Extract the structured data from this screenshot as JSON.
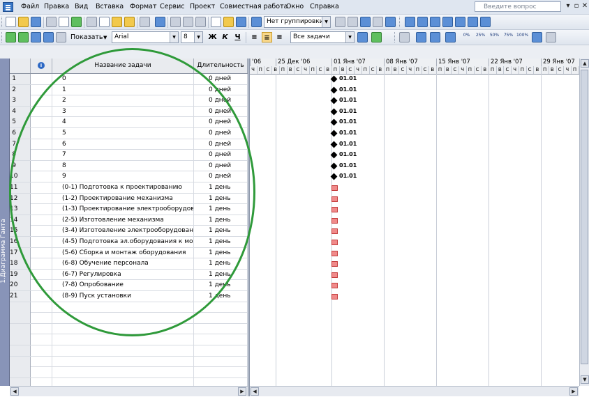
{
  "menu": {
    "items": [
      "Файл",
      "Правка",
      "Вид",
      "Вставка",
      "Формат",
      "Сервис",
      "Проект",
      "Совместная работа",
      "Окно",
      "Справка"
    ],
    "search_placeholder": "Введите вопрос",
    "window_buttons": [
      "▾",
      "▫",
      "✕"
    ]
  },
  "toolbar1": {
    "grouping_value": "Нет группировки"
  },
  "toolbar2": {
    "show_label": "Показать",
    "font_value": "Arial",
    "size_value": "8",
    "bold": "Ж",
    "italic": "К",
    "underline": "Ч",
    "filter_value": "Все задачи",
    "percent_buttons": [
      "0%",
      "25%",
      "50%",
      "75%",
      "100%"
    ]
  },
  "viewbar": {
    "label": "1.Диаграмма Ганта"
  },
  "table": {
    "columns": {
      "id": "",
      "indicator": "",
      "name": "Название задачи",
      "duration": "Длительность"
    },
    "rows": [
      {
        "id": "1",
        "name": "0",
        "duration": "0 дней"
      },
      {
        "id": "2",
        "name": "1",
        "duration": "0 дней"
      },
      {
        "id": "3",
        "name": "2",
        "duration": "0 дней"
      },
      {
        "id": "4",
        "name": "3",
        "duration": "0 дней"
      },
      {
        "id": "5",
        "name": "4",
        "duration": "0 дней"
      },
      {
        "id": "6",
        "name": "5",
        "duration": "0 дней"
      },
      {
        "id": "7",
        "name": "6",
        "duration": "0 дней"
      },
      {
        "id": "8",
        "name": "7",
        "duration": "0 дней"
      },
      {
        "id": "9",
        "name": "8",
        "duration": "0 дней"
      },
      {
        "id": "10",
        "name": "9",
        "duration": "0 дней"
      },
      {
        "id": "11",
        "name": "(0-1) Подготовка к проектированию",
        "duration": "1 день"
      },
      {
        "id": "12",
        "name": "(1-2) Проектирование механизма",
        "duration": "1 день"
      },
      {
        "id": "13",
        "name": "(1-3) Проектирование электрооборудовани",
        "duration": "1 день"
      },
      {
        "id": "14",
        "name": "(2-5) Изготовление механизма",
        "duration": "1 день"
      },
      {
        "id": "15",
        "name": "(3-4) Изготовление электрооборудования",
        "duration": "1 день"
      },
      {
        "id": "16",
        "name": "(4-5) Подготовка эл.оборудования к монтаж",
        "duration": "1 день"
      },
      {
        "id": "17",
        "name": "(5-6) Сборка и монтаж оборудования",
        "duration": "1 день"
      },
      {
        "id": "18",
        "name": "(6-8) Обучение персонала",
        "duration": "1 день"
      },
      {
        "id": "19",
        "name": "(6-7) Регулировка",
        "duration": "1 день"
      },
      {
        "id": "20",
        "name": "(7-8) Опробование",
        "duration": "1 день"
      },
      {
        "id": "21",
        "name": "(8-9) Пуск установки",
        "duration": "1 день"
      }
    ],
    "empty_rows": 8
  },
  "gantt": {
    "weeks": [
      "'06",
      "25 Дек '06",
      "01 Янв '07",
      "08 Янв '07",
      "15 Янв '07",
      "22 Янв '07",
      "29 Янв '07"
    ],
    "day_letters": [
      "Ч",
      "П",
      "С",
      "В",
      "П",
      "В",
      "С",
      "Ч",
      "П",
      "С",
      "В",
      "П",
      "В",
      "С",
      "Ч",
      "П",
      "С",
      "В",
      "П",
      "В",
      "С",
      "Ч",
      "П",
      "С",
      "В",
      "П",
      "В",
      "С",
      "Ч",
      "П",
      "С",
      "В",
      "П",
      "В",
      "С",
      "Ч",
      "П",
      "С",
      "В",
      "П",
      "В",
      "С",
      "Ч",
      "П",
      "С",
      "В",
      "П"
    ],
    "milestone_label": "01.01",
    "milestone_count": 10,
    "task_bar_count": 11,
    "colors": {
      "task_bar": "#f08a8a",
      "task_border": "#c23a3a",
      "annotation_ellipse": "#2f9a3a"
    }
  }
}
